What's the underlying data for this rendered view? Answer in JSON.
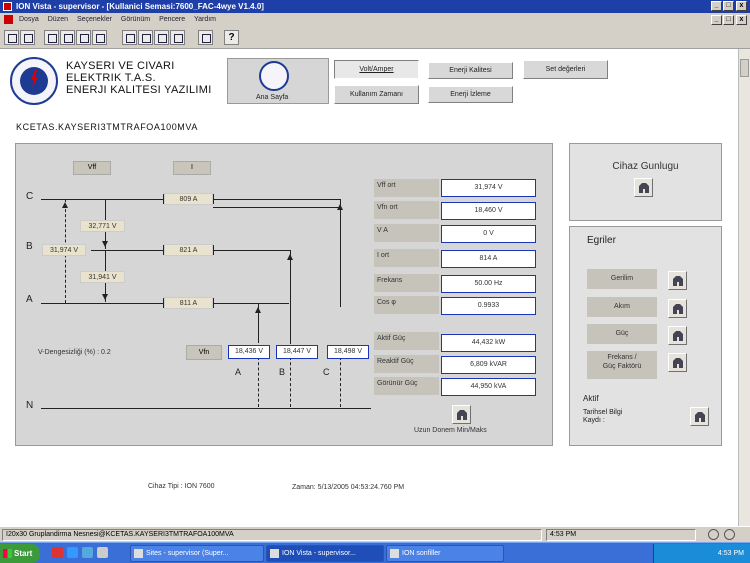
{
  "window": {
    "title": "ION Vista - supervisor - [Kullanici Semasi:7600_FAC-4wye  V1.4.0]",
    "min": "_",
    "restore": "□",
    "close": "x"
  },
  "menu": [
    "Dosya",
    "Düzen",
    "Seçenekler",
    "Görünüm",
    "Pencere",
    "Yardım"
  ],
  "company": {
    "line1": "KAYSERI VE CIVARI",
    "line2": "ELEKTRIK T.A.S.",
    "line3": "ENERJI KALITESI YAZILIMI"
  },
  "nav": {
    "home": "Ana Sayfa",
    "volt": "Volt/Amper",
    "usage": "Kullanım Zamanı",
    "quality": "Enerji Kalitesi",
    "monitor": "Enerji İzleme",
    "setpoints": "Set değerleri"
  },
  "path": "KCETAS.KAYSERI3TMTRAFOA100MVA",
  "diagram": {
    "hdr_vff": "Vff",
    "hdr_i": "I",
    "phase_c": "C",
    "phase_b": "B",
    "phase_a": "A",
    "phase_n": "N",
    "vb": "31,974 V",
    "vca": "32,771 V",
    "vab": "31,941 V",
    "ic": "809 A",
    "ib": "821 A",
    "ia": "811 A",
    "unbalance": "V-Dengesizliği (%) :  0.2",
    "vfn_label": "Vfn",
    "vfn_a": "18,436 V",
    "vfn_b": "18,447 V",
    "vfn_c": "18,498 V",
    "bottom_a": "A",
    "bottom_b": "B",
    "bottom_c": "C"
  },
  "readings": [
    {
      "label": "Vff ort",
      "value": "31,974 V"
    },
    {
      "label": "Vfn ort",
      "value": "18,460 V"
    },
    {
      "label": "V A",
      "value": "0 V"
    },
    {
      "label": "I ort",
      "value": "814 A"
    },
    {
      "label": "Frekans",
      "value": "50.00 Hz"
    },
    {
      "label": "Cos φ",
      "value": "0.9933"
    }
  ],
  "power": [
    {
      "label": "Aktif Güç",
      "value": "44,432 kW"
    },
    {
      "label": "Reaktif Güç",
      "value": "6,809 kVAR"
    },
    {
      "label": "Görünür Güç",
      "value": "44,950 kVA"
    }
  ],
  "longterm": "Uzun Donem Min/Maks",
  "side1": {
    "title": "Cihaz Gunlugu"
  },
  "side2": {
    "title": "Egriler",
    "b1": "Gerilim",
    "b2": "Akım",
    "b3": "Güç",
    "b4a": "Frekans /",
    "b4b": "Güç Faktörü",
    "aktif": "Aktif",
    "tarih1": "Tarihsel Bilgi",
    "tarih2": "Kaydı :"
  },
  "footer": {
    "device": "Cihaz Tipi : ION 7600",
    "time": "Zaman: 5/13/2005 04:53:24.760 PM"
  },
  "status": {
    "left": "I20x30 Gruplandirma Nesnesi@KCETAS.KAYSERI3TMTRAFOA100MVA",
    "time": "4:53 PM"
  },
  "taskbar": {
    "start": "Start",
    "t1": "Sites - supervisor (Super...",
    "t2": "ION Vista - supervisor...",
    "t3": "ION sonfiller",
    "clock": "4:53 PM"
  }
}
